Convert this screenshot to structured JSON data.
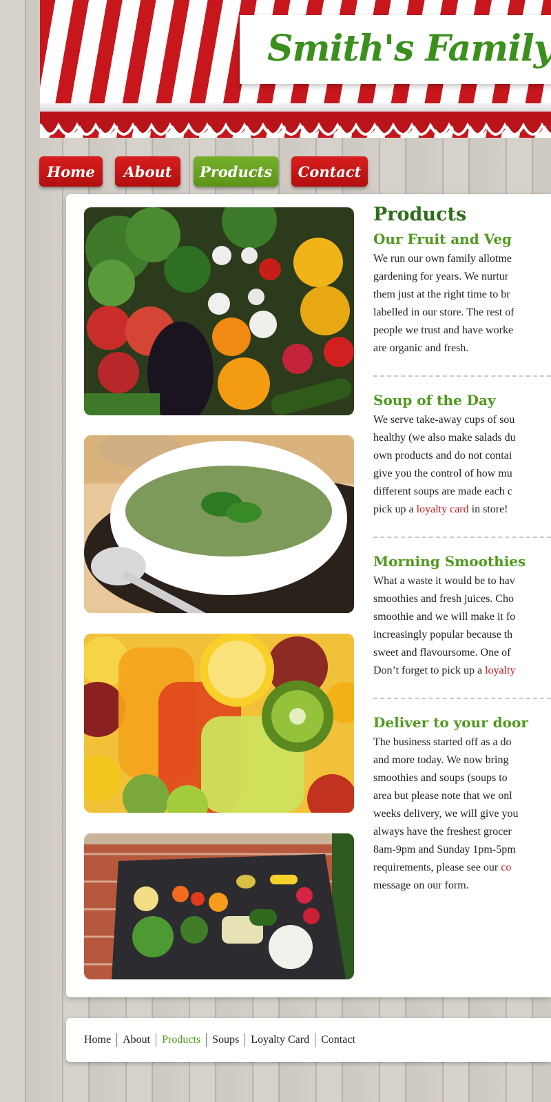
{
  "header": {
    "site_title": "Smith's Family Gree"
  },
  "nav": {
    "home": "Home",
    "about": "About",
    "products": "Products",
    "contact": "Contact"
  },
  "main": {
    "title": "Products",
    "sections": [
      {
        "heading": "Our Fruit and Veg",
        "lines": [
          "We run our own family allotme",
          "gardening for years. We nurtur",
          "them just at the right time to br",
          "labelled in our store. The rest of",
          "people we trust and have worke",
          "are organic and fresh."
        ]
      },
      {
        "heading": "Soup of the Day",
        "lines": [
          "We serve take-away cups of sou",
          "healthy (we also make salads du",
          "own products and do not contai",
          "give you the control of how mu",
          "different soups are made each c"
        ],
        "last_prefix": "pick up a ",
        "last_link": "loyalty card",
        "last_suffix": " in store!"
      },
      {
        "heading": "Morning Smoothies",
        "lines": [
          "What a waste it would be to hav",
          "smoothies and fresh juices. Cho",
          "smoothie and we will make it fo",
          "increasingly popular because th",
          "sweet and flavoursome. One of"
        ],
        "last_prefix": "Don’t forget to pick up a ",
        "last_link": "loyalty"
      },
      {
        "heading": "Deliver to your door",
        "lines": [
          "The business started off as a do",
          "and more today. We now bring",
          "smoothies and soups (soups to",
          "area but please note that we onl",
          "weeks delivery, we will give you",
          "always have the freshest grocer",
          "8am-9pm and Sunday 1pm-5pm"
        ],
        "req_prefix": "requirements, please see our ",
        "req_link": "co",
        "final_line": "message on our form."
      }
    ]
  },
  "footer": {
    "links": [
      "Home",
      "About",
      "Products",
      "Soups",
      "Loyalty Card",
      "Contact"
    ]
  },
  "colors": {
    "awning_red": "#c8171c",
    "title_green": "#3b8f1d",
    "heading_dark_green": "#2e6e1c",
    "heading_green": "#4f9a1d",
    "nav_red": "#c8171c",
    "nav_active_green": "#6aa723",
    "link_red": "#c8171c"
  },
  "images": [
    "fruit-veg-photo",
    "soup-photo",
    "smoothies-photo",
    "delivery-crate-photo"
  ]
}
